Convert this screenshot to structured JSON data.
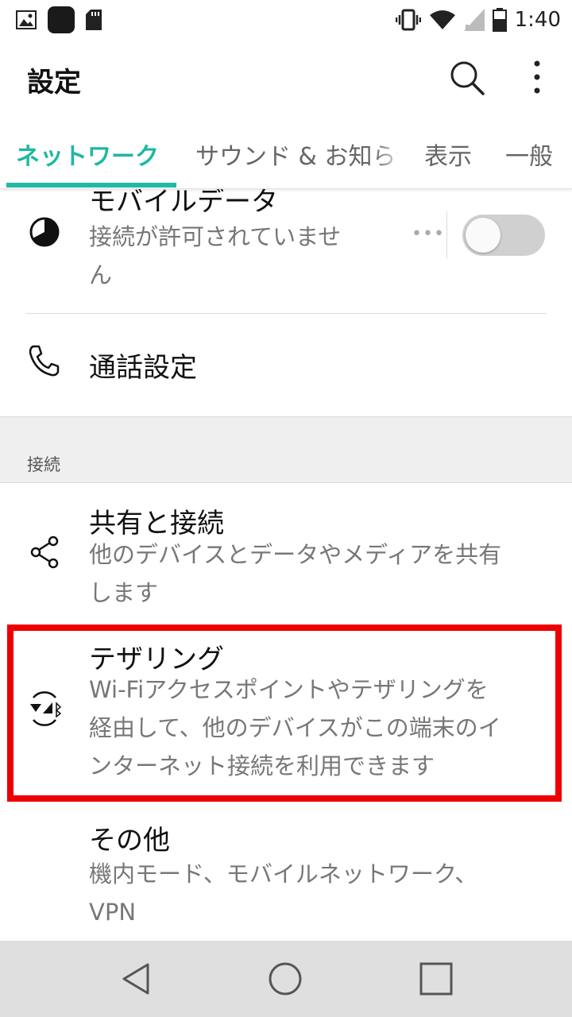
{
  "status_bar": {
    "time": "1:40",
    "icons": [
      "gallery-icon",
      "app-icon",
      "sd-card-icon",
      "vibrate-icon",
      "wifi-icon",
      "signal-icon",
      "battery-icon"
    ]
  },
  "app_bar": {
    "title": "設定",
    "icons": [
      "search-icon",
      "more-vert-icon"
    ]
  },
  "tabs": [
    {
      "label": "ネットワーク",
      "active": true
    },
    {
      "label": "サウンド & お知らせ",
      "active": false
    },
    {
      "label": "表示",
      "active": false
    },
    {
      "label": "一般",
      "active": false
    }
  ],
  "items": {
    "mobile_data": {
      "title": "モバイルデータ",
      "subtitle_line1": "接続が許可されていませ",
      "subtitle_line2": "ん",
      "dots": "•••",
      "toggle_on": false,
      "icon": "data-usage-icon"
    },
    "call_settings": {
      "title": "通話設定",
      "icon": "phone-icon"
    },
    "section_label": "接続",
    "share": {
      "title": "共有と接続",
      "subtitle_line1": "他のデバイスとデータやメディアを共有",
      "subtitle_line2": "します",
      "icon": "share-icon"
    },
    "tethering": {
      "title": "テザリング",
      "subtitle_line1": "Wi-Fiアクセスポイントやテザリングを",
      "subtitle_line2": "経由して、他のデバイスがこの端末のイ",
      "subtitle_line3": "ンターネット接続を利用できます",
      "icon": "tethering-icon"
    },
    "other": {
      "title": "その他",
      "subtitle_line1": "機内モード、モバイルネットワーク、",
      "subtitle_line2": "VPN"
    }
  },
  "nav_bar": {
    "icons": [
      "back-icon",
      "home-icon",
      "recents-icon"
    ]
  },
  "colors": {
    "accent": "#1fb8a1",
    "highlight": "#ee0000",
    "toggle_off": "#d0d0d0"
  }
}
